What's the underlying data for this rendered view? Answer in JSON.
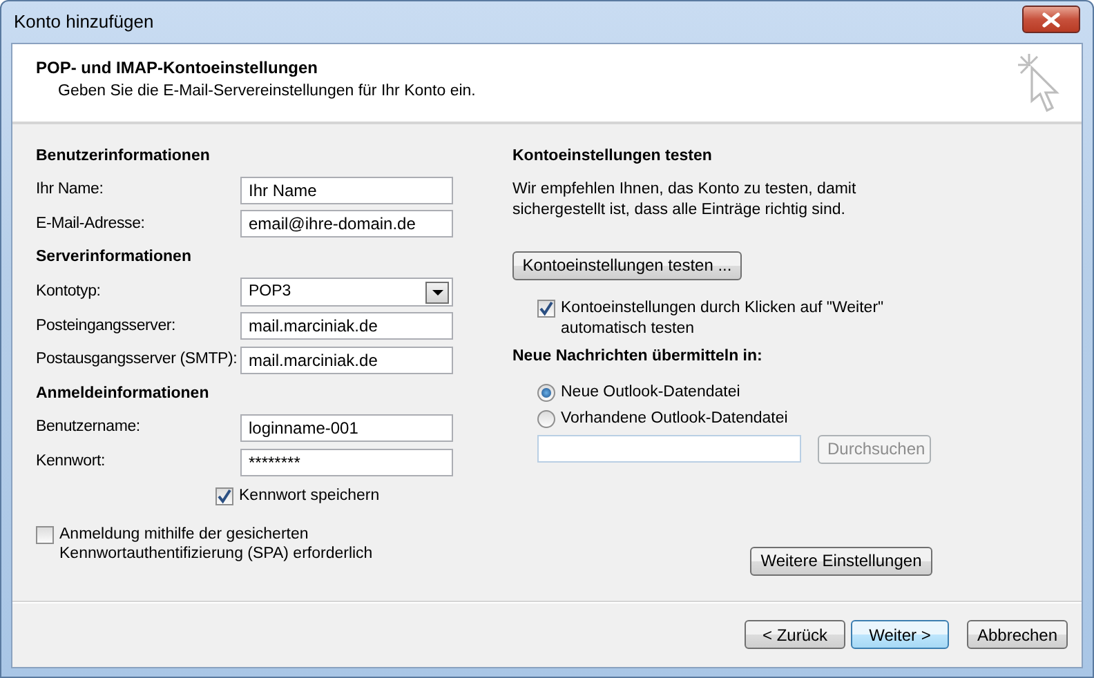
{
  "window": {
    "title": "Konto hinzufügen"
  },
  "header": {
    "title": "POP- und IMAP-Kontoeinstellungen",
    "subtitle": "Geben Sie die E-Mail-Servereinstellungen für Ihr Konto ein."
  },
  "left": [
    {
      "kind": "heading",
      "label": "Benutzerinformationen"
    },
    {
      "kind": "field",
      "label": "Ihr Name:",
      "value": "Ihr Name"
    },
    {
      "kind": "field",
      "label": "E-Mail-Adresse:",
      "value": "email@ihre-domain.de"
    },
    {
      "kind": "heading",
      "label": "Serverinformationen"
    },
    {
      "kind": "dropdown",
      "label": "Kontotyp:",
      "value": "POP3"
    },
    {
      "kind": "field",
      "label": "Posteingangsserver:",
      "value": "mail.marciniak.de"
    },
    {
      "kind": "field",
      "label": "Postausgangsserver (SMTP):",
      "value": "mail.marciniak.de"
    },
    {
      "kind": "heading",
      "label": "Anmeldeinformationen"
    },
    {
      "kind": "field",
      "label": "Benutzername:",
      "value": "loginname-001"
    },
    {
      "kind": "field",
      "label": "Kennwort:",
      "value": "********"
    },
    {
      "kind": "checkbox",
      "label": "Kennwort speichern",
      "checked": true
    },
    {
      "kind": "checkbox_wide",
      "label": "Anmeldung mithilfe der gesicherten Kennwortauthentifizierung (SPA) erforderlich",
      "checked": false
    }
  ],
  "right": {
    "heading": "Kontoeinstellungen testen",
    "paragraph": "Wir empfehlen Ihnen, das Konto zu testen, damit sichergestellt ist, dass alle Einträge richtig sind.",
    "test_button": "Kontoeinstellungen testen ...",
    "auto_test": {
      "label": "Kontoeinstellungen durch Klicken auf \"Weiter\" automatisch testen",
      "checked": true
    },
    "delivery_heading": "Neue Nachrichten übermitteln in:",
    "delivery_options": [
      {
        "label": "Neue Outlook-Datendatei",
        "selected": true
      },
      {
        "label": "Vorhandene Outlook-Datendatei",
        "selected": false
      }
    ],
    "browse_button": {
      "label": "Durchsuchen",
      "disabled": true
    },
    "more_settings_button": "Weitere Einstellungen"
  },
  "footer_buttons": [
    {
      "label": "< Zurück",
      "focused": false
    },
    {
      "label": "Weiter >",
      "focused": true
    },
    {
      "label": "Abbrechen",
      "focused": false
    }
  ]
}
